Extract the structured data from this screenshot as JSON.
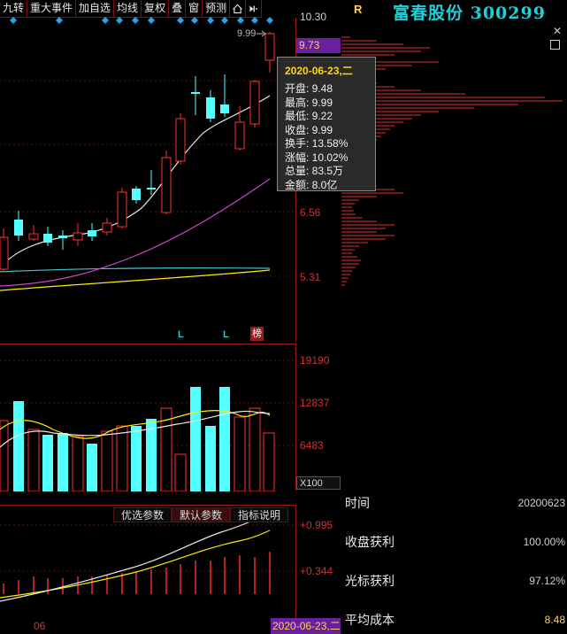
{
  "toolbar": {
    "items": [
      "九转",
      "重大事件",
      "加自选",
      "均线",
      "复权",
      "叠",
      "窗",
      "预测"
    ]
  },
  "header": {
    "r_label": "R",
    "title": "富春股份 300299"
  },
  "price_axis": {
    "max": "10.30",
    "current": "9.73",
    "mid": "6.56",
    "low": "5.31"
  },
  "last_price_label": "9.99",
  "volume_axis": {
    "top": "19190",
    "mid": "12837",
    "low": "6483",
    "unit": "X100"
  },
  "indicator_axis": {
    "top": "+0.995",
    "low": "+0.344"
  },
  "indicator_tabs": [
    "优选参数",
    "默认参数",
    "指标说明"
  ],
  "markers": {
    "l": "L",
    "bang": "榜"
  },
  "date_axis": {
    "month": "06",
    "cursor": "2020-06-23,二"
  },
  "tooltip": {
    "date": "2020-06-23,二",
    "rows": [
      "开盘: 9.48",
      "最高: 9.99",
      "最低: 9.22",
      "收盘: 9.99",
      "换手: 13.58%",
      "涨幅: 10.02%",
      "总量: 83.5万",
      "金额: 8.0亿"
    ]
  },
  "stats": [
    {
      "label": "时间",
      "value": "20200623"
    },
    {
      "label": "收盘获利",
      "value": "100.00%"
    },
    {
      "label": "光标获利",
      "value": "97.12%"
    },
    {
      "label": "平均成本",
      "value": "8.48"
    }
  ],
  "colors": {
    "up": "#ff3030",
    "down": "#54ffff",
    "ma_white": "#e8e8e8",
    "ma_yellow": "#ffee00",
    "ma_magenta": "#cc44cc",
    "ma_cyan": "#40c8c8",
    "accent": "#6a1fa0"
  }
}
